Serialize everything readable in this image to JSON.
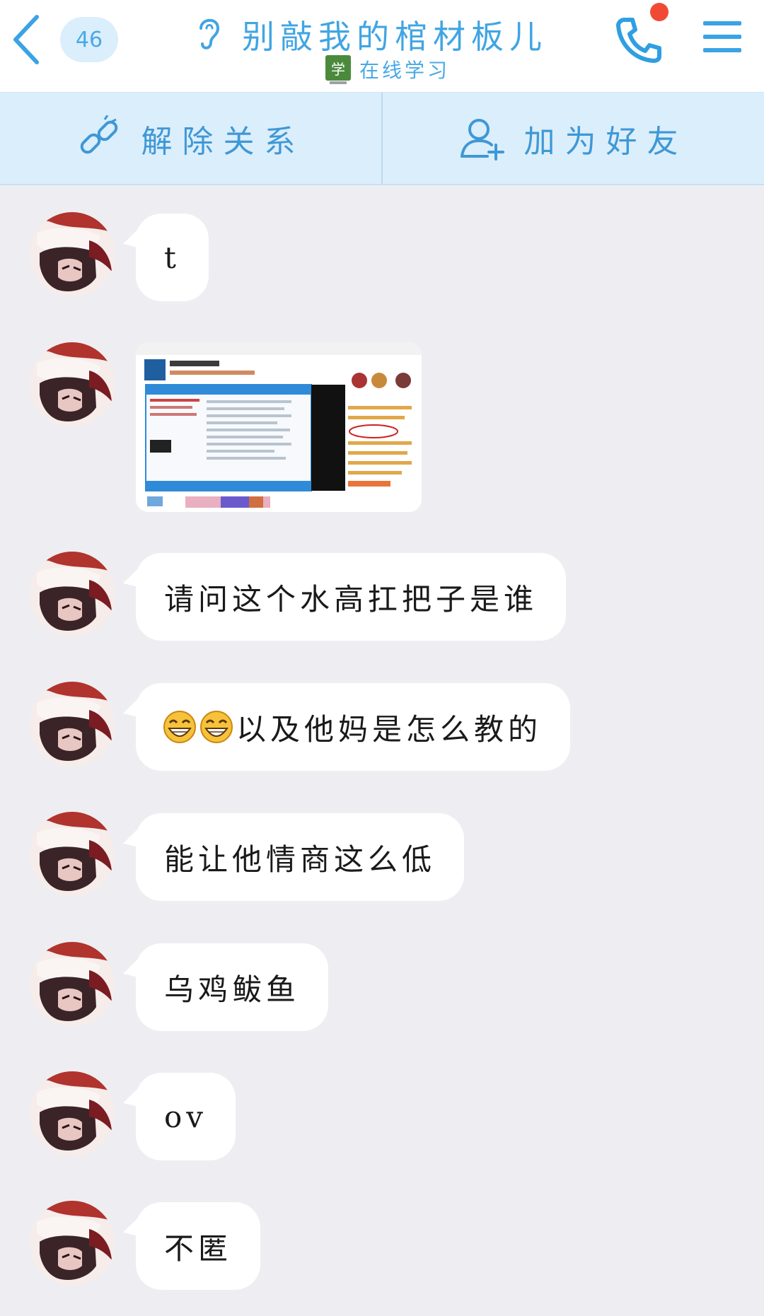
{
  "header": {
    "unread_count": "46",
    "title": "别敲我的棺材板儿",
    "status": "在线学习",
    "status_icon_label": "学",
    "accent": "#41a5e2",
    "call_dot_color": "#f04a37"
  },
  "relation_bar": {
    "unlink_label": "解除关系",
    "add_friend_label": "加为好友"
  },
  "messages": [
    {
      "type": "text",
      "text": "t"
    },
    {
      "type": "image"
    },
    {
      "type": "text",
      "text": "请问这个水高扛把子是谁"
    },
    {
      "type": "text",
      "text": "以及他妈是怎么教的",
      "prefix_emoji": "grin-emoji x2"
    },
    {
      "type": "text",
      "text": "能让他情商这么低"
    },
    {
      "type": "text",
      "text": "乌鸡鲅鱼"
    },
    {
      "type": "text",
      "text": "ov"
    },
    {
      "type": "text",
      "text": "不匿"
    }
  ]
}
